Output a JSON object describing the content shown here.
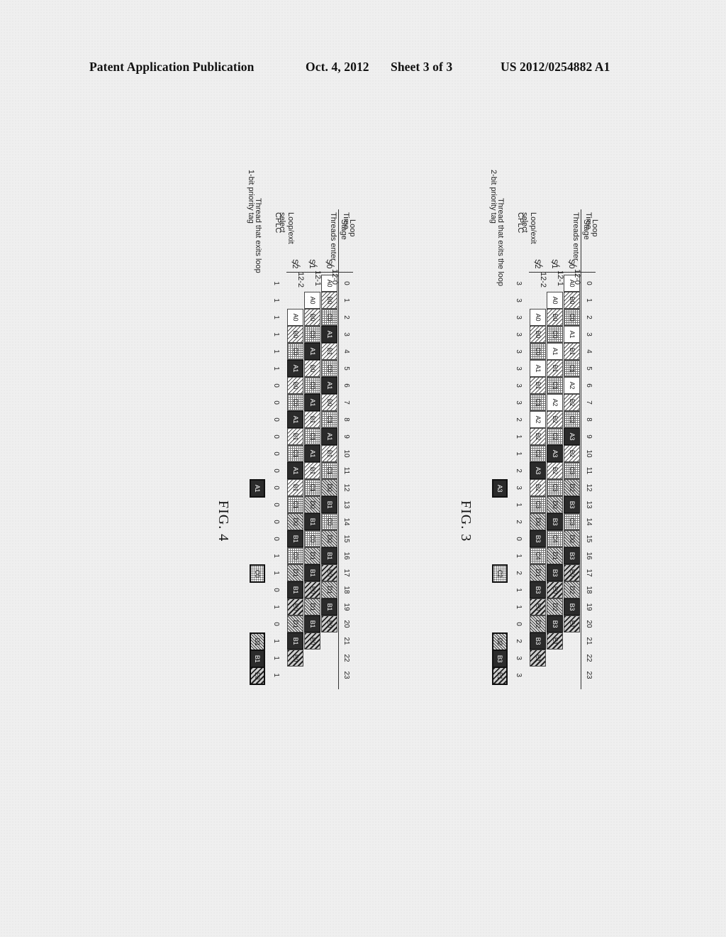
{
  "header": {
    "publication": "Patent Application Publication",
    "date": "Oct. 4, 2012",
    "sheet": "Sheet 3 of 3",
    "number": "US 2012/0254882 A1"
  },
  "figures": [
    {
      "id": "figure-3",
      "caption": "FIG. 3",
      "priority_tag_label": "2-bit priority tag",
      "time_label": "Time",
      "threads_enter_label": "Threads enter",
      "loop_exit_select_label": "Loop/exit\nselect",
      "loop_exit_select_line1": "Loop/exit",
      "loop_exit_select_line2": "select",
      "cplc_label": "CPLC",
      "loop_label": "Loop",
      "stage_label": "Stage",
      "exit_caption": "Thread that exits the loop",
      "stage_names": [
        "S0",
        "S1",
        "S2"
      ],
      "lead_refs": [
        "12-0",
        "12-1",
        "12-2"
      ],
      "ticks": [
        0,
        1,
        2,
        3,
        4,
        5,
        6,
        7,
        8,
        9,
        10,
        11,
        12,
        13,
        14,
        15,
        16,
        17,
        18,
        19,
        20,
        21,
        22,
        23
      ],
      "rows": [
        {
          "stage": "S0",
          "cells": [
            {
              "t": 0,
              "label": "A0",
              "p": "p-A"
            },
            {
              "t": 1,
              "label": "B0",
              "p": "p-B"
            },
            {
              "t": 2,
              "label": "C0",
              "p": "p-C"
            },
            {
              "t": 3,
              "label": "A1",
              "p": "p-A"
            },
            {
              "t": 4,
              "label": "B1",
              "p": "p-B"
            },
            {
              "t": 5,
              "label": "C1",
              "p": "p-C"
            },
            {
              "t": 6,
              "label": "A2",
              "p": "p-A"
            },
            {
              "t": 7,
              "label": "B2",
              "p": "p-B"
            },
            {
              "t": 8,
              "label": "C2",
              "p": "p-C"
            },
            {
              "t": 9,
              "label": "A3",
              "p": "p-dark"
            },
            {
              "t": 10,
              "label": "B2",
              "p": "p-B"
            },
            {
              "t": 11,
              "label": "C3",
              "p": "p-C"
            },
            {
              "t": 12,
              "label": "D2",
              "p": "p-D"
            },
            {
              "t": 13,
              "label": "B3",
              "p": "p-dark"
            },
            {
              "t": 14,
              "label": "C3",
              "p": "p-C"
            },
            {
              "t": 15,
              "label": "D0",
              "p": "p-D"
            },
            {
              "t": 16,
              "label": "B3",
              "p": "p-dark"
            },
            {
              "t": 17,
              "label": "E0",
              "p": "p-E"
            },
            {
              "t": 18,
              "label": "D2",
              "p": "p-D"
            },
            {
              "t": 19,
              "label": "B3",
              "p": "p-dark"
            },
            {
              "t": 20,
              "label": "E1",
              "p": "p-E"
            }
          ]
        },
        {
          "stage": "S1",
          "cells": [
            {
              "t": 1,
              "label": "A0",
              "p": "p-A"
            },
            {
              "t": 2,
              "label": "B0",
              "p": "p-B"
            },
            {
              "t": 3,
              "label": "C0",
              "p": "p-C"
            },
            {
              "t": 4,
              "label": "A1",
              "p": "p-A"
            },
            {
              "t": 5,
              "label": "B1",
              "p": "p-B"
            },
            {
              "t": 6,
              "label": "C1",
              "p": "p-C"
            },
            {
              "t": 7,
              "label": "A2",
              "p": "p-A"
            },
            {
              "t": 8,
              "label": "B2",
              "p": "p-B"
            },
            {
              "t": 9,
              "label": "C2",
              "p": "p-C"
            },
            {
              "t": 10,
              "label": "A3",
              "p": "p-dark"
            },
            {
              "t": 11,
              "label": "B2",
              "p": "p-B"
            },
            {
              "t": 12,
              "label": "C3",
              "p": "p-C"
            },
            {
              "t": 13,
              "label": "D0",
              "p": "p-D"
            },
            {
              "t": 14,
              "label": "B3",
              "p": "p-dark"
            },
            {
              "t": 15,
              "label": "C4",
              "p": "p-C"
            },
            {
              "t": 16,
              "label": "D1",
              "p": "p-D"
            },
            {
              "t": 17,
              "label": "B3",
              "p": "p-dark"
            },
            {
              "t": 18,
              "label": "E0",
              "p": "p-E"
            },
            {
              "t": 19,
              "label": "D2",
              "p": "p-D"
            },
            {
              "t": 20,
              "label": "B3",
              "p": "p-dark"
            },
            {
              "t": 21,
              "label": "E1",
              "p": "p-E"
            }
          ]
        },
        {
          "stage": "S2",
          "cells": [
            {
              "t": 2,
              "label": "A0",
              "p": "p-A"
            },
            {
              "t": 3,
              "label": "B0",
              "p": "p-B"
            },
            {
              "t": 4,
              "label": "C0",
              "p": "p-C"
            },
            {
              "t": 5,
              "label": "A1",
              "p": "p-A"
            },
            {
              "t": 6,
              "label": "B1",
              "p": "p-B"
            },
            {
              "t": 7,
              "label": "C1",
              "p": "p-C"
            },
            {
              "t": 8,
              "label": "A2",
              "p": "p-A"
            },
            {
              "t": 9,
              "label": "B2",
              "p": "p-B"
            },
            {
              "t": 10,
              "label": "C2",
              "p": "p-C"
            },
            {
              "t": 11,
              "label": "A3",
              "p": "p-dark"
            },
            {
              "t": 12,
              "label": "B2",
              "p": "p-B"
            },
            {
              "t": 13,
              "label": "C3",
              "p": "p-C"
            },
            {
              "t": 14,
              "label": "D0",
              "p": "p-D"
            },
            {
              "t": 15,
              "label": "B3",
              "p": "p-dark"
            },
            {
              "t": 16,
              "label": "C4",
              "p": "p-C"
            },
            {
              "t": 17,
              "label": "D1",
              "p": "p-D"
            },
            {
              "t": 18,
              "label": "B3",
              "p": "p-dark"
            },
            {
              "t": 19,
              "label": "E0",
              "p": "p-E"
            },
            {
              "t": 20,
              "label": "D2",
              "p": "p-D"
            },
            {
              "t": 21,
              "label": "B3",
              "p": "p-dark"
            },
            {
              "t": 22,
              "label": "E1",
              "p": "p-E"
            }
          ]
        }
      ],
      "cplc_values": [
        3,
        3,
        3,
        3,
        3,
        3,
        3,
        3,
        2,
        1,
        1,
        2,
        3,
        1,
        2,
        0,
        1,
        2,
        1,
        1,
        0,
        2,
        3,
        3
      ],
      "exit_markers": [
        {
          "t": 12,
          "label": "A3",
          "p": "p-dark"
        },
        {
          "t": 17,
          "label": "C2",
          "p": "p-dot"
        },
        {
          "t": 21,
          "label": "D2",
          "p": "p-D"
        },
        {
          "t": 22,
          "label": "B3",
          "p": "p-dark"
        },
        {
          "t": 23,
          "label": "E1",
          "p": "p-E"
        }
      ]
    },
    {
      "id": "figure-4",
      "caption": "FIG. 4",
      "priority_tag_label": "1-bit priority tag",
      "time_label": "Time",
      "threads_enter_label": "Threads enter",
      "loop_exit_select_line1": "Loop/exit",
      "loop_exit_select_line2": "select",
      "cplc_label": "CPLC",
      "loop_label": "Loop",
      "stage_label": "Stage",
      "exit_caption": "Thread that exits loop",
      "stage_names": [
        "S0",
        "S1",
        "S2"
      ],
      "lead_refs": [
        "12-0",
        "12-1",
        "12-2"
      ],
      "ticks": [
        0,
        1,
        2,
        3,
        4,
        5,
        6,
        7,
        8,
        9,
        10,
        11,
        12,
        13,
        14,
        15,
        16,
        17,
        18,
        19,
        20,
        21,
        22,
        23
      ],
      "rows": [
        {
          "stage": "S0",
          "cells": [
            {
              "t": 0,
              "label": "A0",
              "p": "p-A"
            },
            {
              "t": 1,
              "label": "B0",
              "p": "p-B"
            },
            {
              "t": 2,
              "label": "C0",
              "p": "p-C"
            },
            {
              "t": 3,
              "label": "A1",
              "p": "p-dark"
            },
            {
              "t": 4,
              "label": "B1",
              "p": "p-B"
            },
            {
              "t": 5,
              "label": "C0",
              "p": "p-C"
            },
            {
              "t": 6,
              "label": "A1",
              "p": "p-dark"
            },
            {
              "t": 7,
              "label": "B0",
              "p": "p-B"
            },
            {
              "t": 8,
              "label": "C1",
              "p": "p-C"
            },
            {
              "t": 9,
              "label": "A1",
              "p": "p-dark"
            },
            {
              "t": 10,
              "label": "B1",
              "p": "p-B"
            },
            {
              "t": 11,
              "label": "C1",
              "p": "p-C"
            },
            {
              "t": 12,
              "label": "D0",
              "p": "p-D"
            },
            {
              "t": 13,
              "label": "B1",
              "p": "p-dark"
            },
            {
              "t": 14,
              "label": "C0",
              "p": "p-C"
            },
            {
              "t": 15,
              "label": "D0",
              "p": "p-D"
            },
            {
              "t": 16,
              "label": "B1",
              "p": "p-dark"
            },
            {
              "t": 17,
              "label": "E0",
              "p": "p-E"
            },
            {
              "t": 18,
              "label": "D1",
              "p": "p-D"
            },
            {
              "t": 19,
              "label": "B1",
              "p": "p-dark"
            },
            {
              "t": 20,
              "label": "E0",
              "p": "p-E"
            }
          ]
        },
        {
          "stage": "S1",
          "cells": [
            {
              "t": 1,
              "label": "A0",
              "p": "p-A"
            },
            {
              "t": 2,
              "label": "B0",
              "p": "p-B"
            },
            {
              "t": 3,
              "label": "C0",
              "p": "p-C"
            },
            {
              "t": 4,
              "label": "A1",
              "p": "p-dark"
            },
            {
              "t": 5,
              "label": "B0",
              "p": "p-B"
            },
            {
              "t": 6,
              "label": "C0",
              "p": "p-C"
            },
            {
              "t": 7,
              "label": "A1",
              "p": "p-dark"
            },
            {
              "t": 8,
              "label": "B1",
              "p": "p-B"
            },
            {
              "t": 9,
              "label": "C1",
              "p": "p-C"
            },
            {
              "t": 10,
              "label": "A1",
              "p": "p-dark"
            },
            {
              "t": 11,
              "label": "B1",
              "p": "p-B"
            },
            {
              "t": 12,
              "label": "C1",
              "p": "p-C"
            },
            {
              "t": 13,
              "label": "D0",
              "p": "p-D"
            },
            {
              "t": 14,
              "label": "B1",
              "p": "p-dark"
            },
            {
              "t": 15,
              "label": "C0",
              "p": "p-C"
            },
            {
              "t": 16,
              "label": "D1",
              "p": "p-D"
            },
            {
              "t": 17,
              "label": "B1",
              "p": "p-dark"
            },
            {
              "t": 18,
              "label": "E0",
              "p": "p-E"
            },
            {
              "t": 19,
              "label": "D1",
              "p": "p-D"
            },
            {
              "t": 20,
              "label": "B1",
              "p": "p-dark"
            },
            {
              "t": 21,
              "label": "E0",
              "p": "p-E"
            }
          ]
        },
        {
          "stage": "S2",
          "cells": [
            {
              "t": 2,
              "label": "A0",
              "p": "p-A"
            },
            {
              "t": 3,
              "label": "B0",
              "p": "p-B"
            },
            {
              "t": 4,
              "label": "C0",
              "p": "p-C"
            },
            {
              "t": 5,
              "label": "A1",
              "p": "p-dark"
            },
            {
              "t": 6,
              "label": "B0",
              "p": "p-B"
            },
            {
              "t": 7,
              "label": "C0",
              "p": "p-C"
            },
            {
              "t": 8,
              "label": "A1",
              "p": "p-dark"
            },
            {
              "t": 9,
              "label": "B1",
              "p": "p-B"
            },
            {
              "t": 10,
              "label": "C1",
              "p": "p-C"
            },
            {
              "t": 11,
              "label": "A1",
              "p": "p-dark"
            },
            {
              "t": 12,
              "label": "B1",
              "p": "p-B"
            },
            {
              "t": 13,
              "label": "C1",
              "p": "p-C"
            },
            {
              "t": 14,
              "label": "D0",
              "p": "p-D"
            },
            {
              "t": 15,
              "label": "B1",
              "p": "p-dark"
            },
            {
              "t": 16,
              "label": "C0",
              "p": "p-C"
            },
            {
              "t": 17,
              "label": "D1",
              "p": "p-D"
            },
            {
              "t": 18,
              "label": "B1",
              "p": "p-dark"
            },
            {
              "t": 19,
              "label": "E0",
              "p": "p-E"
            },
            {
              "t": 20,
              "label": "D1",
              "p": "p-D"
            },
            {
              "t": 21,
              "label": "B1",
              "p": "p-dark"
            },
            {
              "t": 22,
              "label": "E0",
              "p": "p-E"
            }
          ]
        }
      ],
      "cplc_values": [
        1,
        1,
        1,
        1,
        1,
        1,
        0,
        0,
        0,
        0,
        0,
        0,
        0,
        0,
        0,
        0,
        1,
        1,
        0,
        1,
        0,
        1,
        1,
        1
      ],
      "exit_markers": [
        {
          "t": 12,
          "label": "A1",
          "p": "p-dark"
        },
        {
          "t": 17,
          "label": "C0",
          "p": "p-dot"
        },
        {
          "t": 21,
          "label": "D1",
          "p": "p-D"
        },
        {
          "t": 22,
          "label": "B1",
          "p": "p-dark"
        },
        {
          "t": 23,
          "label": "E0",
          "p": "p-E"
        }
      ]
    }
  ]
}
